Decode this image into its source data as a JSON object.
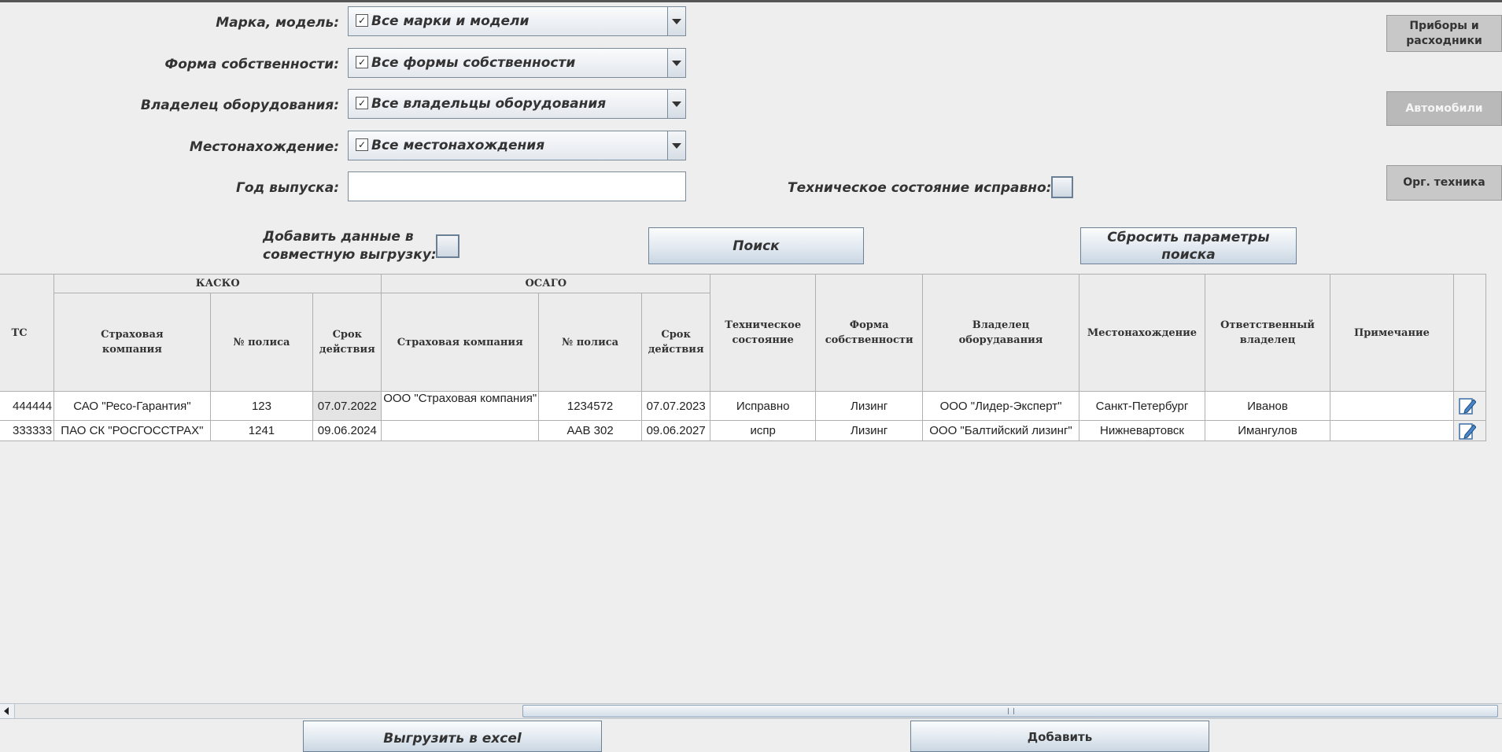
{
  "filters": {
    "brand_label": "Марка, модель:",
    "brand_value": "Все марки и модели",
    "ownership_label": "Форма собственности:",
    "ownership_value": "Все формы собственности",
    "owner_label": "Владелец оборудования:",
    "owner_value": "Все владельцы оборудования",
    "location_label": "Местонахождение:",
    "location_value": "Все местонахождения",
    "year_label": "Год выпуска:",
    "year_value": "",
    "tech_state_label": "Техническое состояние исправно:",
    "joint_export_label_line1": "Добавить данные в",
    "joint_export_label_line2": "совместную выгрузку:",
    "checkmark": "✓"
  },
  "actions": {
    "search": "Поиск",
    "reset_line1": "Сбросить параметры",
    "reset_line2": "поиска",
    "export_excel": "Выгрузить в excel",
    "add": "Добавить"
  },
  "side_nav": {
    "devices_line1": "Приборы и",
    "devices_line2": "расходники",
    "cars": "Автомобили",
    "office": "Орг. техника"
  },
  "table": {
    "group_headers": {
      "kasko": "КАСКО",
      "osago": "ОСАГО"
    },
    "headers": {
      "ts": "ТС",
      "kasko_company_l1": "Страховая",
      "kasko_company_l2": "компания",
      "kasko_policy": "№ полиса",
      "kasko_term_l1": "Срок",
      "kasko_term_l2": "действия",
      "osago_company": "Страховая компания",
      "osago_policy": "№ полиса",
      "osago_term_l1": "Срок",
      "osago_term_l2": "действия",
      "tech_state_l1": "Техническое",
      "tech_state_l2": "состояние",
      "ownership_l1": "Форма",
      "ownership_l2": "собственности",
      "owner_l1": "Владелец",
      "owner_l2": "оборудавания",
      "location": "Местонахождение",
      "responsible_l1": "Ответственный",
      "responsible_l2": "владелец",
      "note": "Примечание"
    },
    "rows": [
      {
        "ts": "444444",
        "kasko_company": "САО \"Ресо-Гарантия\"",
        "kasko_policy": "123",
        "kasko_term": "07.07.2022",
        "osago_company": "ООО \"Страховая компания\"",
        "osago_policy": "1234572",
        "osago_term": "07.07.2023",
        "tech_state": "Исправно",
        "ownership": "Лизинг",
        "owner": "ООО \"Лидер-Эксперт\"",
        "location": "Санкт-Петербург",
        "responsible": "Иванов",
        "note": ""
      },
      {
        "ts": "333333",
        "kasko_company": "ПАО СК \"РОСГОССТРАХ\"",
        "kasko_policy": "1241",
        "kasko_term": "09.06.2024",
        "osago_company": "",
        "osago_policy": "ААВ 302",
        "osago_term": "09.06.2027",
        "tech_state": "испр",
        "ownership": "Лизинг",
        "owner": "ООО \"Балтийский лизинг\"",
        "location": "Нижневартовск",
        "responsible": "Имангулов",
        "note": ""
      }
    ]
  },
  "icons": {
    "edit": "edit-document-icon",
    "scroll_left": "arrow-left-icon"
  },
  "colors": {
    "background": "#eeeeee",
    "button_gradient_top": "#fbfcfd",
    "button_gradient_bottom": "#c9d6e3",
    "border": "#6e8094"
  }
}
